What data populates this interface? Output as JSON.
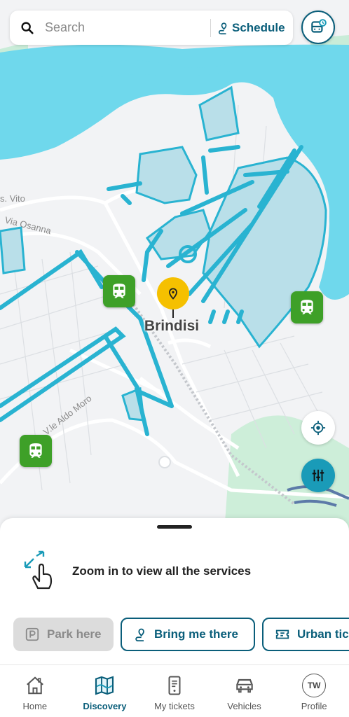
{
  "search": {
    "placeholder": "Search",
    "schedule_label": "Schedule"
  },
  "map": {
    "city_label": "Brindisi",
    "street_labels": [
      "s. Vito",
      "Via Osanna",
      "V.le Aldo Moro"
    ],
    "station_icon": "train-icon",
    "pin_icon": "location-pin-icon"
  },
  "sheet": {
    "zoom_message": "Zoom in to view all the services",
    "chips": {
      "park": "Park here",
      "bring": "Bring me there",
      "urban": "Urban tic"
    }
  },
  "nav": {
    "items": [
      {
        "label": "Home",
        "icon": "home-icon"
      },
      {
        "label": "Discovery",
        "icon": "map-icon"
      },
      {
        "label": "My tickets",
        "icon": "ticket-icon"
      },
      {
        "label": "Vehicles",
        "icon": "car-icon"
      },
      {
        "label": "Profile",
        "initials": "TW"
      }
    ],
    "active": "Discovery"
  },
  "colors": {
    "brand": "#0a5e7a",
    "accent": "#1a9bb8",
    "sea": "#6fd8ec",
    "station_green": "#3ea028",
    "pin_yellow": "#f5c000"
  }
}
